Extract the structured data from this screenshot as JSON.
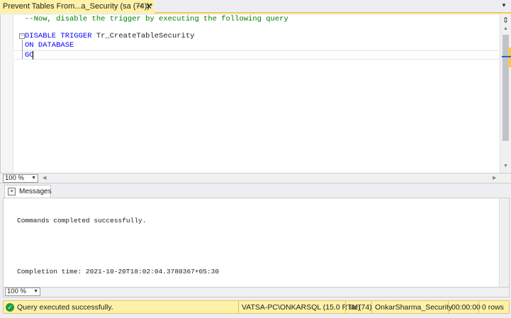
{
  "tab": {
    "title": "Prevent Tables From...a_Security (sa (74))*",
    "pin_icon": "pin-icon",
    "close_icon": "close-icon"
  },
  "editor": {
    "lines": {
      "comment": "--Now, disable the trigger by executing the following query",
      "disable": "DISABLE TRIGGER",
      "trigger_name": "Tr_CreateTableSecurity",
      "on_database": "ON DATABASE",
      "go": "GO"
    },
    "zoom": "100 %"
  },
  "results": {
    "tab_label": "Messages",
    "messages": [
      "Commands completed successfully.",
      "",
      "Completion time: 2021-10-20T18:02:04.3780367+05:30"
    ],
    "zoom": "100 %"
  },
  "status": {
    "message": "Query executed successfully.",
    "server": "VATSA-PC\\ONKARSQL (15.0 RTM)",
    "user": "sa (74)",
    "database": "OnkarSharma_Security",
    "elapsed": "00:00:00",
    "rows": "0 rows"
  },
  "colors": {
    "accent": "#f5cc4a",
    "status_bg": "#fff1a8",
    "keyword": "#0000ff",
    "comment": "#008000",
    "success": "#1f9a3a"
  }
}
